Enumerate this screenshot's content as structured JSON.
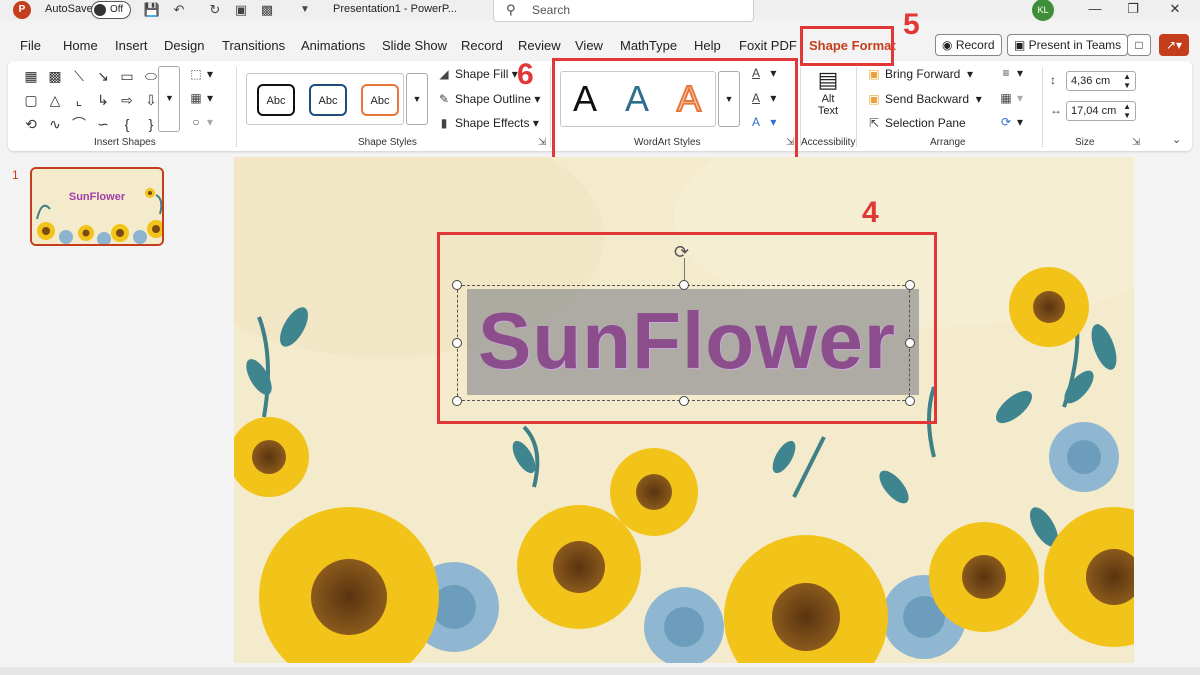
{
  "titlebar": {
    "app_logo": "P",
    "autosave_label": "AutoSave",
    "autosave_state": "Off",
    "doc_title": "Presentation1  -  PowerP...",
    "search_placeholder": "Search",
    "user_initials": "KL"
  },
  "menu": {
    "tabs": [
      "File",
      "Home",
      "Insert",
      "Design",
      "Transitions",
      "Animations",
      "Slide Show",
      "Record",
      "Review",
      "View",
      "MathType",
      "Help",
      "Foxit PDF",
      "Shape Format"
    ],
    "active_tab": "Shape Format",
    "record_button": "Record",
    "present_button": "Present in Teams"
  },
  "ribbon": {
    "insert_shapes": {
      "label": "Insert Shapes"
    },
    "shape_styles": {
      "label": "Shape Styles",
      "presets": [
        "Abc",
        "Abc",
        "Abc"
      ],
      "fill": "Shape Fill",
      "outline": "Shape Outline",
      "effects": "Shape Effects"
    },
    "wordart_styles": {
      "label": "WordArt Styles",
      "presets": [
        "A",
        "A",
        "A"
      ]
    },
    "accessibility": {
      "label": "Accessibility",
      "alt_text_line1": "Alt",
      "alt_text_line2": "Text"
    },
    "arrange": {
      "label": "Arrange",
      "bring_forward": "Bring Forward",
      "send_backward": "Send Backward",
      "selection_pane": "Selection Pane"
    },
    "size": {
      "label": "Size",
      "height": "4,36 cm",
      "width": "17,04 cm"
    }
  },
  "annotations": {
    "n4": "4",
    "n5": "5",
    "n6": "6"
  },
  "slides_pane": {
    "slide_number": "1",
    "thumb_title": "SunFlower"
  },
  "slide": {
    "title": "SunFlower"
  },
  "colors": {
    "accent": "#c43e1c",
    "annotation_red": "#e13737",
    "title_purple": "#8c4d8d",
    "slide_bg": "#f4ebcd"
  }
}
